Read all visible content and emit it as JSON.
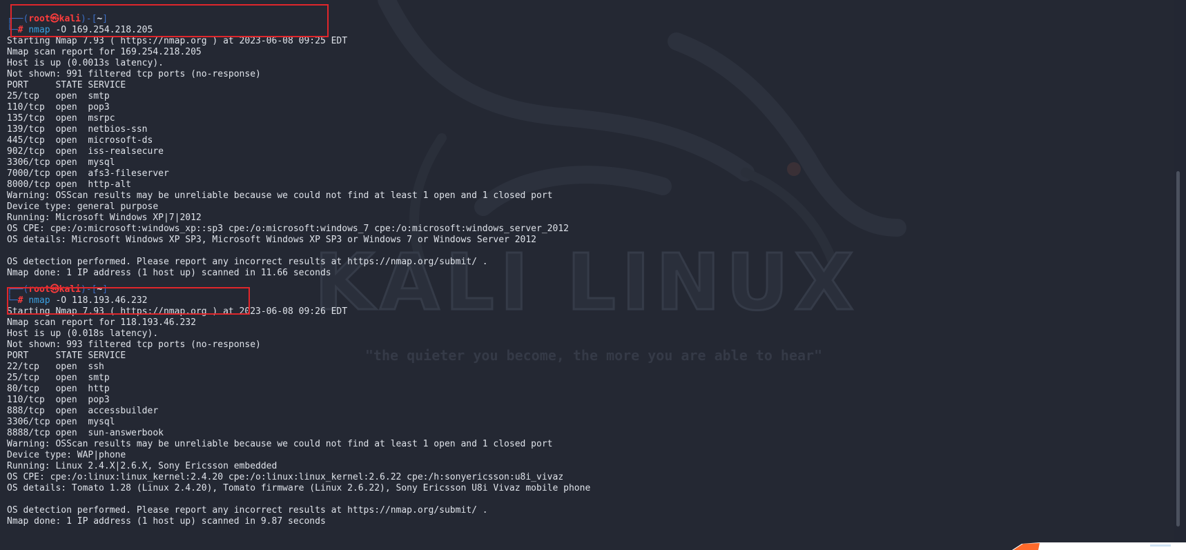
{
  "terminal": {
    "prompt": {
      "box_top": "┌──(",
      "user": "root㉿kali",
      "mid": ")-[",
      "dir": "~",
      "end": "]",
      "box_bottom": "└─",
      "hash": "#"
    },
    "scans": [
      {
        "cmd": "nmap",
        "flag": "-O",
        "target": "169.254.218.205",
        "output": [
          "Starting Nmap 7.93 ( https://nmap.org ) at 2023-06-08 09:25 EDT",
          "Nmap scan report for 169.254.218.205",
          "Host is up (0.0013s latency).",
          "Not shown: 991 filtered tcp ports (no-response)",
          "PORT     STATE SERVICE",
          "25/tcp   open  smtp",
          "110/tcp  open  pop3",
          "135/tcp  open  msrpc",
          "139/tcp  open  netbios-ssn",
          "445/tcp  open  microsoft-ds",
          "902/tcp  open  iss-realsecure",
          "3306/tcp open  mysql",
          "7000/tcp open  afs3-fileserver",
          "8000/tcp open  http-alt",
          "Warning: OSScan results may be unreliable because we could not find at least 1 open and 1 closed port",
          "Device type: general purpose",
          "Running: Microsoft Windows XP|7|2012",
          "OS CPE: cpe:/o:microsoft:windows_xp::sp3 cpe:/o:microsoft:windows_7 cpe:/o:microsoft:windows_server_2012",
          "OS details: Microsoft Windows XP SP3, Microsoft Windows XP SP3 or Windows 7 or Windows Server 2012",
          "",
          "OS detection performed. Please report any incorrect results at https://nmap.org/submit/ .",
          "Nmap done: 1 IP address (1 host up) scanned in 11.66 seconds"
        ]
      },
      {
        "cmd": "nmap",
        "flag": "-O",
        "target": "118.193.46.232",
        "output": [
          "Starting Nmap 7.93 ( https://nmap.org ) at 2023-06-08 09:26 EDT",
          "Nmap scan report for 118.193.46.232",
          "Host is up (0.018s latency).",
          "Not shown: 993 filtered tcp ports (no-response)",
          "PORT     STATE SERVICE",
          "22/tcp   open  ssh",
          "25/tcp   open  smtp",
          "80/tcp   open  http",
          "110/tcp  open  pop3",
          "888/tcp  open  accessbuilder",
          "3306/tcp open  mysql",
          "8888/tcp open  sun-answerbook",
          "Warning: OSScan results may be unreliable because we could not find at least 1 open and 1 closed port",
          "Device type: WAP|phone",
          "Running: Linux 2.4.X|2.6.X, Sony Ericsson embedded",
          "OS CPE: cpe:/o:linux:linux_kernel:2.4.20 cpe:/o:linux:linux_kernel:2.6.22 cpe:/h:sonyericsson:u8i_vivaz",
          "OS details: Tomato 1.28 (Linux 2.4.20), Tomato firmware (Linux 2.6.22), Sony Ericsson U8i Vivaz mobile phone",
          "",
          "OS detection performed. Please report any incorrect results at https://nmap.org/submit/ .",
          "Nmap done: 1 IP address (1 host up) scanned in 9.87 seconds"
        ]
      }
    ]
  },
  "watermark": {
    "title": "KALI LINUX",
    "tagline": "\"the quieter you become, the more you are able to hear\""
  },
  "colors": {
    "background": "#242833",
    "text": "#dfe3ea",
    "prompt_user": "#ff3c3c",
    "prompt_box": "#3c6ec4",
    "command": "#3aa0e0",
    "highlight_box": "#e0262b"
  },
  "icons": {
    "tray": "tray-app-icon",
    "scrollbar": "scrollbar"
  }
}
